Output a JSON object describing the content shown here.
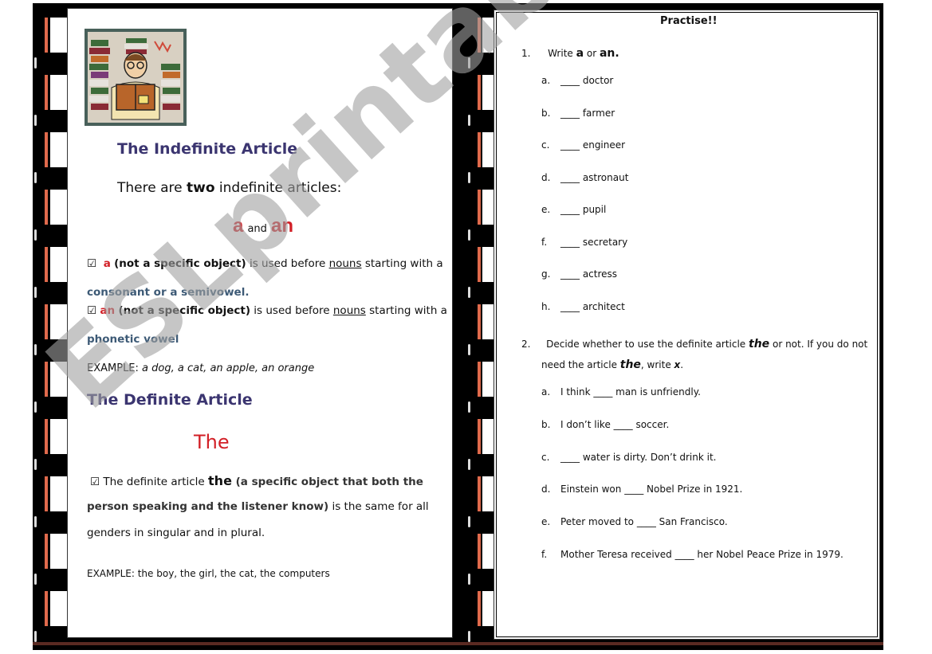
{
  "left_page": {
    "illustration": "person-reading-books-illustration",
    "indefinite_heading": "The Indefinite Article",
    "intro_prefix": "There are ",
    "intro_bold": "two",
    "intro_suffix": " indefinite articles:",
    "article_a": "a",
    "article_and": "and",
    "article_an": "an",
    "rule1": {
      "icon": "checkbox-checked-icon",
      "article": "a",
      "bold_part": "(not a specific object)",
      "text1": " is used before ",
      "underlined": "nouns",
      "text2": " starting  with a",
      "continuation": "consonant or a semivowel."
    },
    "rule2": {
      "icon": "checkbox-checked-icon",
      "article": "an",
      "bold_part": "(not a specific object)",
      "text1": " is used before ",
      "underlined": "nouns",
      "text2": " starting with a",
      "continuation": "phonetic vowel"
    },
    "example1_label": "EXAMPLE: ",
    "example1_text": "a dog, a cat, an apple, an orange",
    "definite_heading": "The Definite Article",
    "the_word": "The",
    "rule3": {
      "icon": "checkbox-checked-icon",
      "text1": "The definite article ",
      "bold_the": "the",
      "bold_part1": " (a specific object that both the",
      "bold_part2": "person speaking and the listener know)",
      "text2": " is the same for all",
      "text3": "genders in singular and in plural."
    },
    "example2": "EXAMPLE:  the boy, the girl, the cat, the computers"
  },
  "right_page": {
    "title": "Practise!!",
    "exercise1": {
      "number": "1.",
      "prefix": "Write ",
      "a": "a",
      "or": " or ",
      "an": "an.",
      "blank": "____",
      "items": [
        {
          "letter": "a.",
          "word": "doctor"
        },
        {
          "letter": "b.",
          "word": "farmer"
        },
        {
          "letter": "c.",
          "word": "engineer"
        },
        {
          "letter": "d.",
          "word": "astronaut"
        },
        {
          "letter": "e.",
          "word": "pupil"
        },
        {
          "letter": "f.",
          "word": "secretary"
        },
        {
          "letter": "g.",
          "word": "actress"
        },
        {
          "letter": "h.",
          "word": "architect"
        }
      ]
    },
    "exercise2": {
      "number": "2.",
      "line1_prefix": "Decide whether to use the definite article ",
      "the": "the",
      "line1_suffix": "  or not. If you do not",
      "line2_prefix": "need the article ",
      "line2_mid": ", write ",
      "x": "x",
      "line2_end": ".",
      "items": [
        {
          "letter": "a.",
          "text": "I think ____ man is unfriendly."
        },
        {
          "letter": "b.",
          "text": "I don’t like ____  soccer."
        },
        {
          "letter": "c.",
          "text": "____  water is dirty. Don’t drink it."
        },
        {
          "letter": "d.",
          "text": "Einstein won ____ Nobel Prize in 1921."
        },
        {
          "letter": "e.",
          "text": "Peter moved to ____  San Francisco."
        },
        {
          "letter": "f.",
          "text": "Mother Teresa received ____ her Nobel Peace Prize in 1979."
        }
      ]
    }
  },
  "watermark": "ESLprintables.com",
  "colors": {
    "heading": "#3b3570",
    "red_accent": "#d21f26",
    "blue_bold": "#3d5a76",
    "film_red": "#e06a4c"
  }
}
